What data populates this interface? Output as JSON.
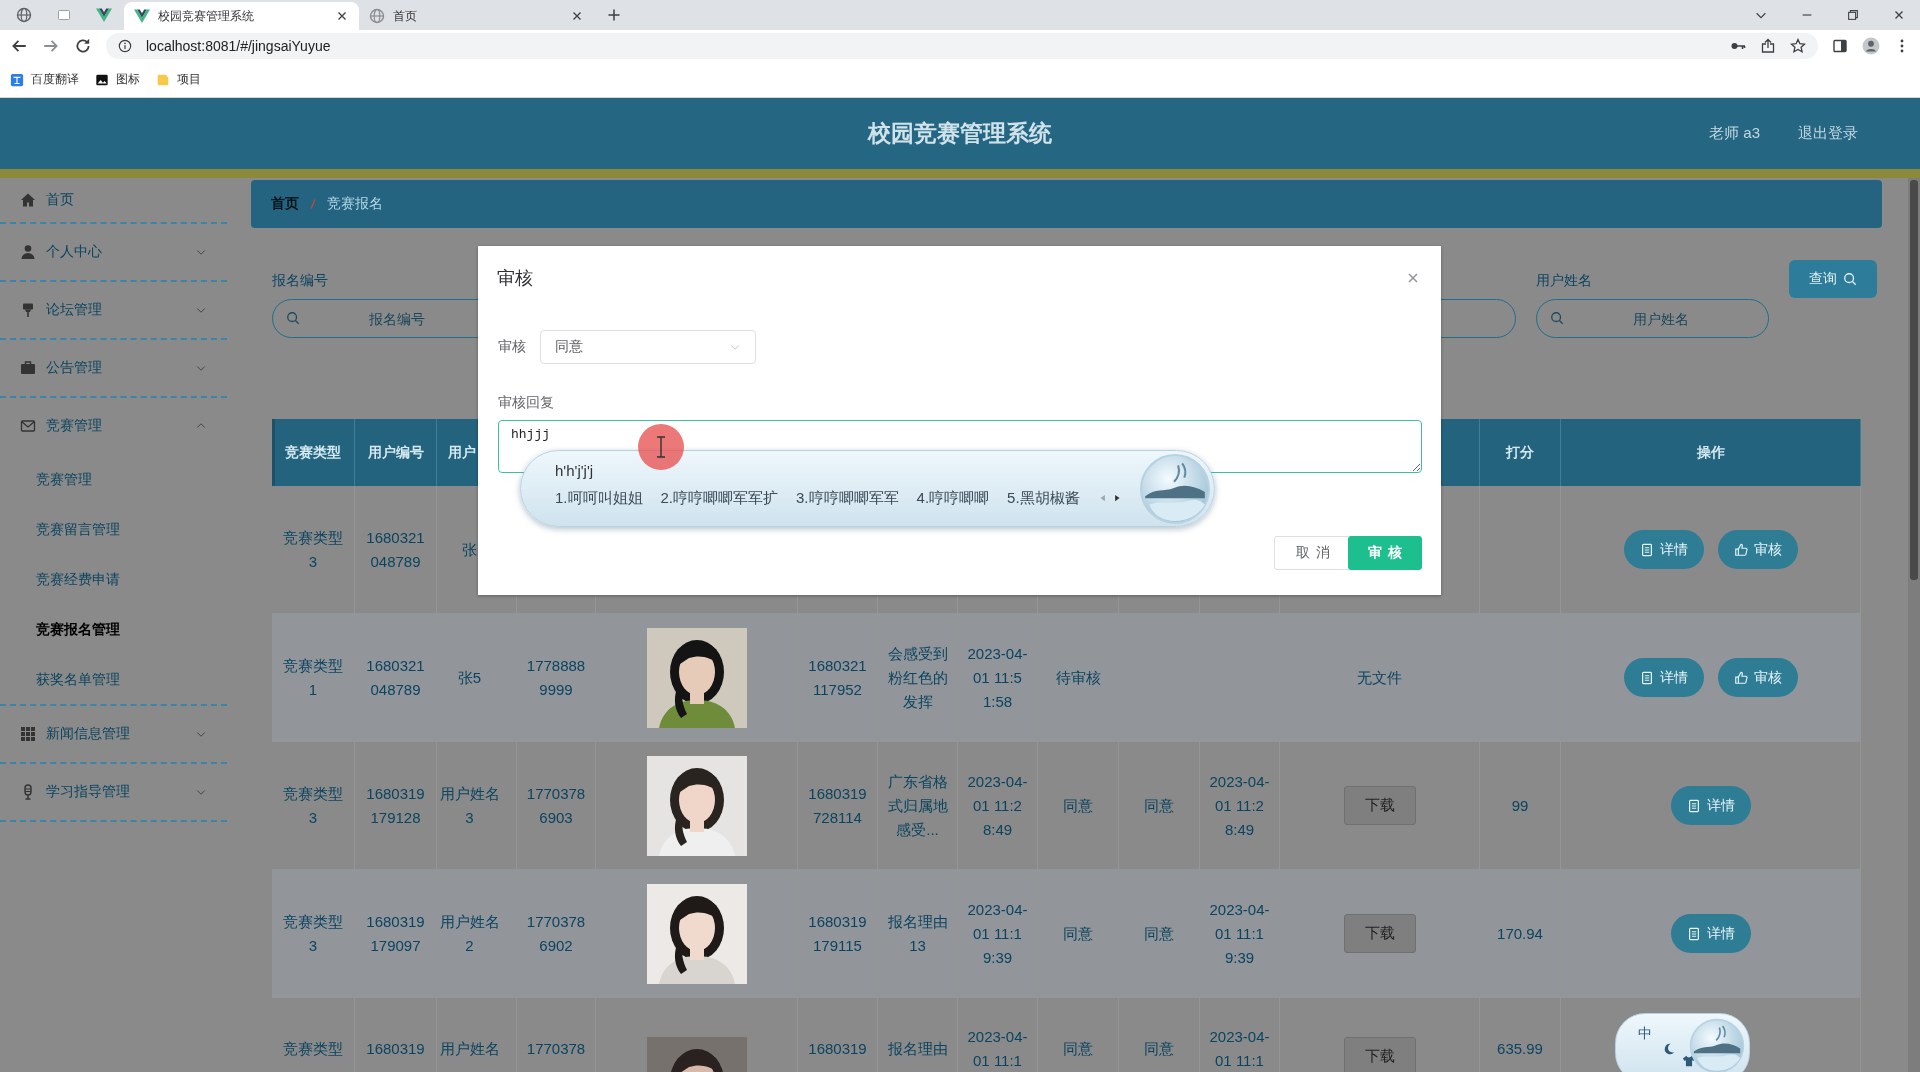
{
  "browser": {
    "tabs": [
      {
        "title": "校园竞赛管理系统",
        "selected": true
      },
      {
        "title": "首页",
        "selected": false
      }
    ],
    "address": "localhost:8081/#/jingsaiYuyue",
    "bookmarks": [
      "百度翻译",
      "图标",
      "项目"
    ]
  },
  "header": {
    "title": "校园竞赛管理系统",
    "user": "老师 a3",
    "logout": "退出登录"
  },
  "sidebar": {
    "items": [
      {
        "label": "首页",
        "kind": "link"
      },
      {
        "label": "个人中心",
        "kind": "menu",
        "expanded": false
      },
      {
        "label": "论坛管理",
        "kind": "menu",
        "expanded": false
      },
      {
        "label": "公告管理",
        "kind": "menu",
        "expanded": false
      },
      {
        "label": "竞赛管理",
        "kind": "menu",
        "expanded": true,
        "children": [
          {
            "label": "竞赛管理",
            "selected": false
          },
          {
            "label": "竞赛留言管理",
            "selected": false
          },
          {
            "label": "竞赛经费申请",
            "selected": false
          },
          {
            "label": "竞赛报名管理",
            "selected": true
          },
          {
            "label": "获奖名单管理",
            "selected": false
          }
        ]
      },
      {
        "label": "新闻信息管理",
        "kind": "menu",
        "expanded": false
      },
      {
        "label": "学习指导管理",
        "kind": "menu",
        "expanded": false
      }
    ]
  },
  "breadcrumb": [
    "首页",
    "竞赛报名"
  ],
  "search": {
    "fields": [
      {
        "label": "报名编号",
        "placeholder": "报名编号",
        "covered": false
      },
      {
        "covered": true
      },
      {
        "label": "用户姓名",
        "placeholder": "用户姓名",
        "covered": false
      }
    ],
    "button": "查询"
  },
  "table": {
    "columns": [
      {
        "label": "竞赛类型"
      },
      {
        "label": "用户编号"
      },
      {
        "label": "用户"
      },
      {},
      {},
      {},
      {},
      {},
      {},
      {},
      {},
      {},
      {
        "label": "打分"
      },
      {
        "label": "操作"
      }
    ],
    "rows": [
      {
        "type": "竞赛类型 3",
        "user_id": "1680321048789",
        "user_name": "张",
        "actions": [
          {
            "label": "详情",
            "kind": "detail"
          },
          {
            "label": "审核",
            "kind": "review"
          }
        ]
      },
      {
        "type": "竞赛类型 1",
        "user_id": "1680321048789",
        "user_name": "张5",
        "phone": "17788889999",
        "photo": {
          "kind": "picture"
        },
        "reg_id": "1680321117952",
        "reason": "会感受到粉红色的发挥",
        "time": "2023-04-01 11:51:58",
        "status": "待审核",
        "file": {
          "kind": "text",
          "label": "无文件"
        },
        "actions": [
          {
            "label": "详情",
            "kind": "detail"
          },
          {
            "label": "审核",
            "kind": "review"
          }
        ]
      },
      {
        "type": "竞赛类型 3",
        "user_id": "1680319179128",
        "user_name": "用户姓名 3",
        "phone": "17703786903",
        "photo": {
          "kind": "picture"
        },
        "reg_id": "1680319728114",
        "reason": "广东省格式归属地感受...",
        "time": "2023-04-01 11:28:49",
        "status": "同意",
        "reply": "同意",
        "review_time": "2023-04-01 11:28:49",
        "file": {
          "kind": "button",
          "label": "下载"
        },
        "score": "99",
        "actions": [
          {
            "label": "详情",
            "kind": "detail"
          }
        ]
      },
      {
        "type": "竞赛类型 3",
        "user_id": "1680319179097",
        "user_name": "用户姓名 2",
        "phone": "17703786902",
        "photo": {
          "kind": "picture"
        },
        "reg_id": "1680319179115",
        "reason": "报名理由 13",
        "time": "2023-04-01 11:19:39",
        "status": "同意",
        "reply": "同意",
        "review_time": "2023-04-01 11:19:39",
        "file": {
          "kind": "button",
          "label": "下载"
        },
        "score": "170.94",
        "actions": [
          {
            "label": "详情",
            "kind": "detail"
          }
        ]
      },
      {
        "type": "竞赛类型",
        "user_id": "1680319",
        "user_name": "用户姓名",
        "phone": "1770378",
        "photo": {
          "kind": "picture"
        },
        "reg_id": "1680319",
        "reason": "报名理由",
        "time": "2023-04-01 11:1",
        "status": "同意",
        "reply": "同意",
        "review_time": "2023-04-01 11:1",
        "file": {
          "kind": "button",
          "label": "下载"
        },
        "score": "635.99"
      }
    ]
  },
  "dialog": {
    "title": "审核",
    "fields": [
      {
        "kind": "select",
        "label": "审核",
        "value": "同意"
      },
      {
        "kind": "textarea",
        "label": "审核回复",
        "value": "hhjjj"
      }
    ],
    "buttons": [
      {
        "label": "取消",
        "kind": "default"
      },
      {
        "label": "审核",
        "kind": "primary"
      }
    ]
  },
  "ime": {
    "composition": "h'h'j'j'j",
    "candidates": [
      "1.呵呵叫姐姐",
      "2.哼哼唧唧军军扩",
      "3.哼哼唧唧军军",
      "4.哼哼唧唧",
      "5.黑胡椒酱"
    ]
  },
  "ime_status": {
    "mode": "中"
  }
}
